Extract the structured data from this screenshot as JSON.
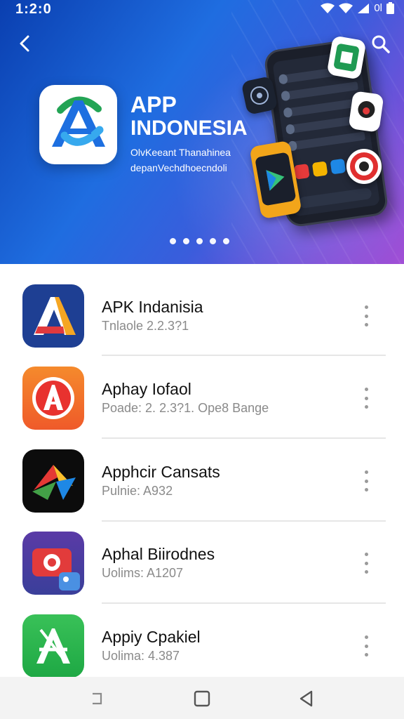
{
  "status_bar": {
    "time": "1:2:0",
    "battery_label": "0l"
  },
  "hero": {
    "title_line1": "APP",
    "title_line2": "INDONESIA",
    "subtitle_line1": "OlvKeeant Thanahinea",
    "subtitle_line2": "depanVechdhoecndoli",
    "carousel_dots": 5
  },
  "apps": [
    {
      "name": "APK Indanisia",
      "meta": "Tnlaole 2.2.3?1"
    },
    {
      "name": "Aphay Iofaol",
      "meta": "Poade: 2. 2.3?1.  Ope8 Bange"
    },
    {
      "name": "Apphcir Cansats",
      "meta": "Pulnie: A932"
    },
    {
      "name": "Aphal Biirodnes",
      "meta": "Uolims: A1207"
    },
    {
      "name": "Appiy Cpakiel",
      "meta": "Uolima: 4.387"
    }
  ],
  "colors": {
    "hero_gradient_start": "#0a3fb0",
    "hero_gradient_end": "#a24fd6",
    "icon1": "#1e3f93",
    "icon2": "#f57a2a",
    "icon3": "#0c0c0c",
    "icon4": "#4a3a9a",
    "icon5": "#22b24a"
  }
}
